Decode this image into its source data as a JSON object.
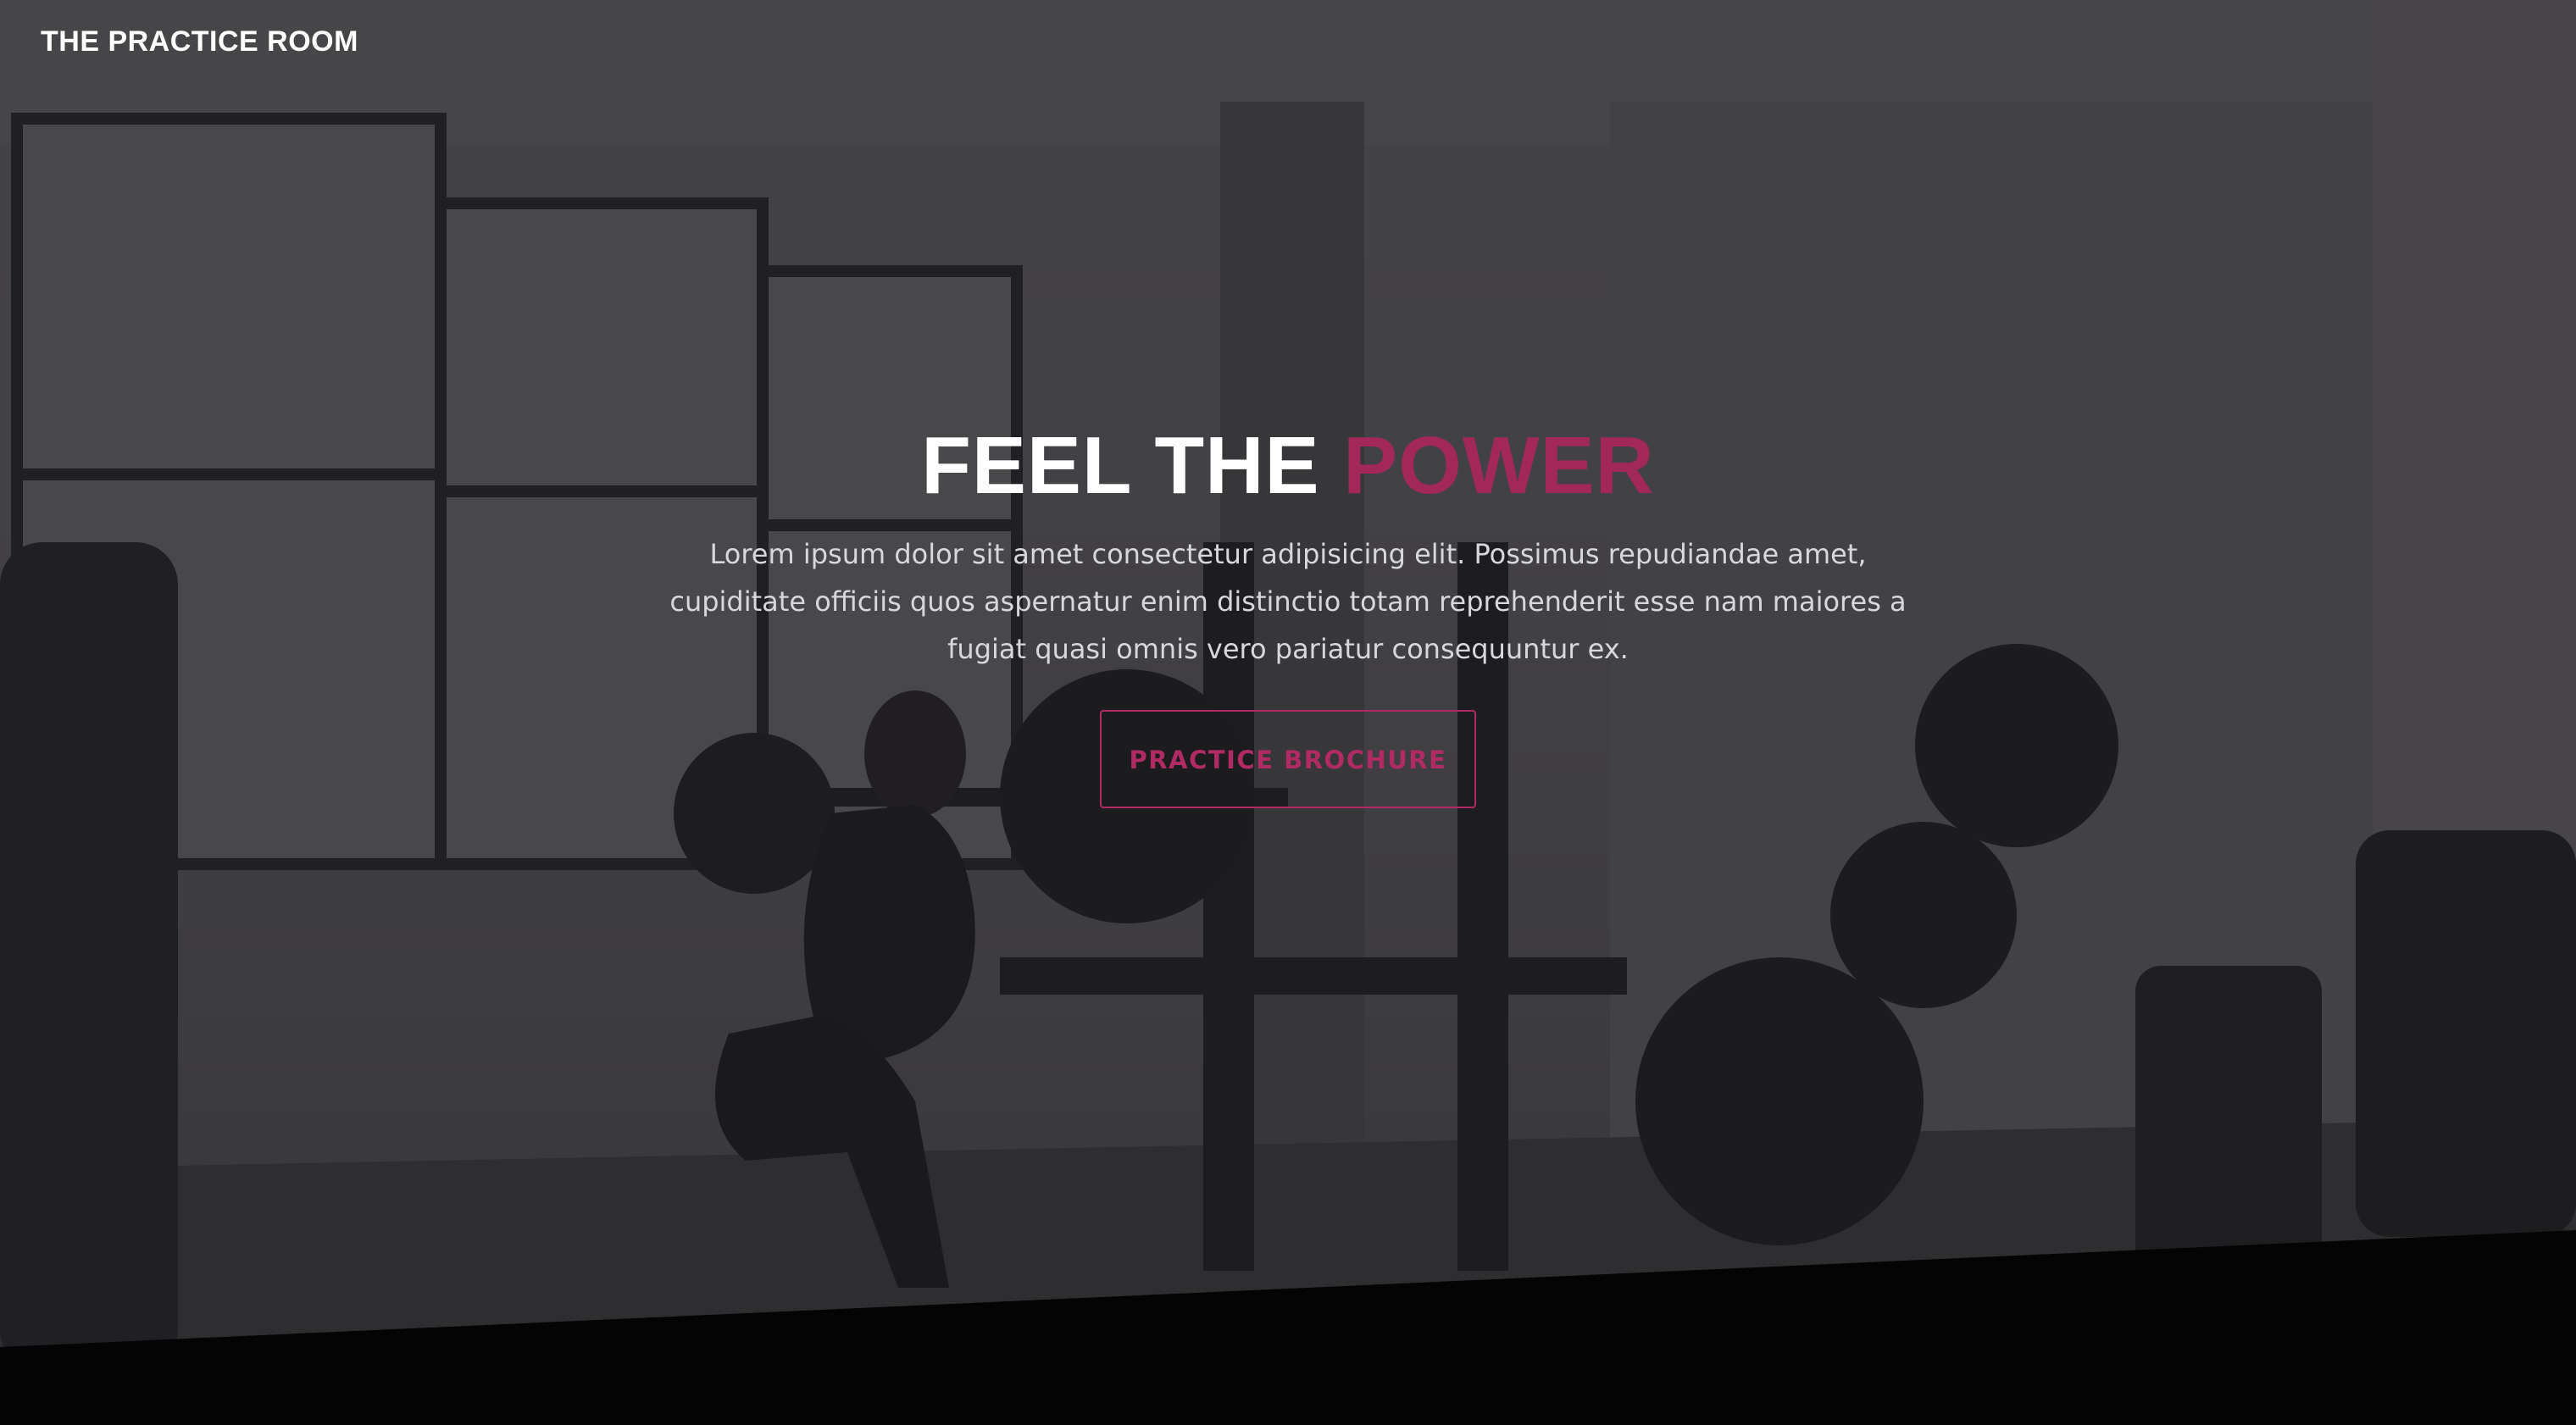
{
  "brand": {
    "name": "THE PRACTICE ROOM"
  },
  "hero": {
    "headline_prefix": "FEEL THE ",
    "headline_accent": "POWER",
    "lead": "Lorem ipsum dolor sit amet consectetur adipisicing elit. Possimus repudiandae amet, cupiditate officiis quos aspernatur enim distinctio totam reprehenderit esse nam maiores a fugiat quasi omnis vero pariatur consequuntur ex.",
    "cta_label": "PRACTICE BROCHURE",
    "background_image": "gym-interior-barbell-squat"
  },
  "colors": {
    "accent": "#a3285a",
    "text": "#ffffff",
    "overlay": "#1e1d21",
    "bottom_band": "#040404"
  }
}
